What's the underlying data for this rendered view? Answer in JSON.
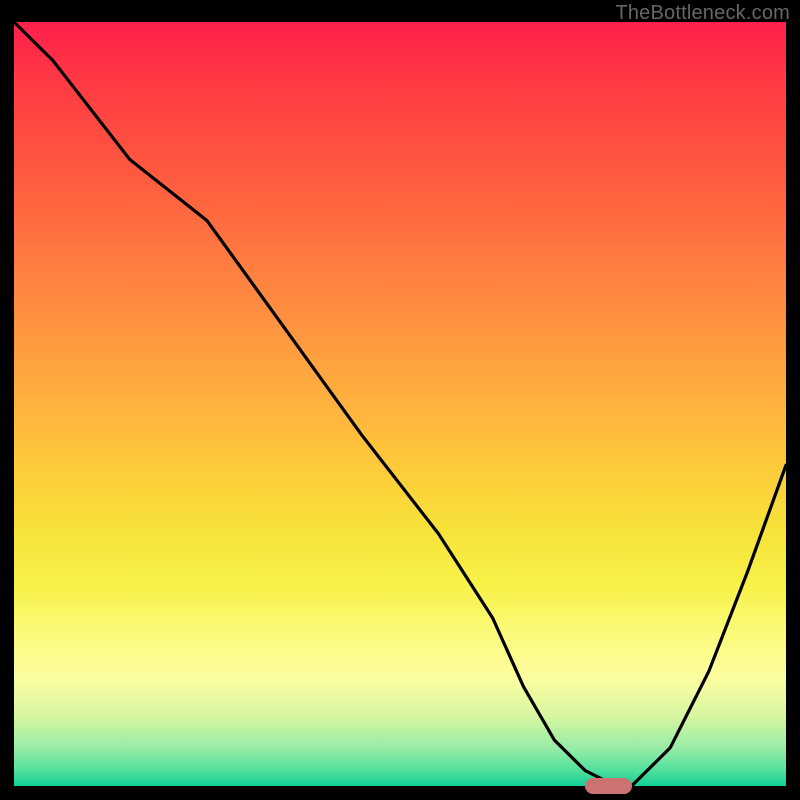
{
  "watermark": "TheBottleneck.com",
  "chart_data": {
    "type": "line",
    "title": "",
    "xlabel": "",
    "ylabel": "",
    "xlim": [
      0,
      100
    ],
    "ylim": [
      0,
      100
    ],
    "grid": false,
    "series": [
      {
        "name": "curve",
        "x": [
          0,
          5,
          15,
          25,
          35,
          45,
          55,
          62,
          66,
          70,
          74,
          78,
          80,
          85,
          90,
          95,
          100
        ],
        "values": [
          100,
          95,
          82,
          74,
          60,
          46,
          33,
          22,
          13,
          6,
          2,
          0,
          0,
          5,
          15,
          28,
          42
        ]
      }
    ],
    "marker": {
      "x_start": 74,
      "x_end": 80,
      "y": 0
    },
    "colors": {
      "background_top": "#ff204b",
      "background_mid": "#f7e139",
      "background_bottom": "#11d196",
      "curve": "#000000",
      "frame": "#000000",
      "marker": "#cb7372"
    }
  }
}
